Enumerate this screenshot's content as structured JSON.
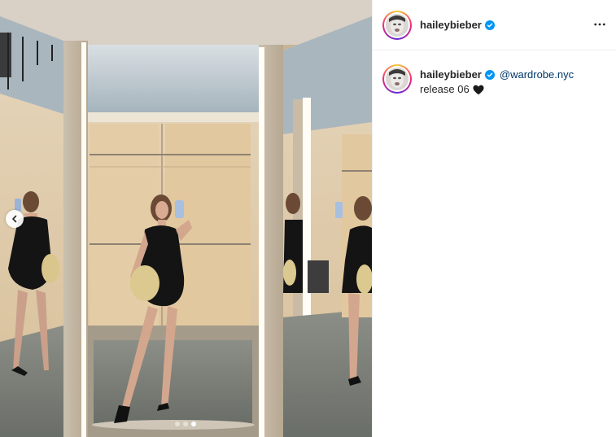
{
  "post": {
    "username": "haileybieber",
    "verified": true,
    "mention": "@wardrobe.nyc",
    "caption": "release 06",
    "caption_emoji": "black-heart-icon"
  },
  "carousel": {
    "slide_count": 3,
    "active_index": 2
  },
  "icons": {
    "prev": "chevron-left-icon",
    "more": "more-options-icon",
    "verified": "verified-badge-icon"
  },
  "colors": {
    "verified": "#0095f6",
    "mention": "#00376b",
    "text": "#262626"
  }
}
